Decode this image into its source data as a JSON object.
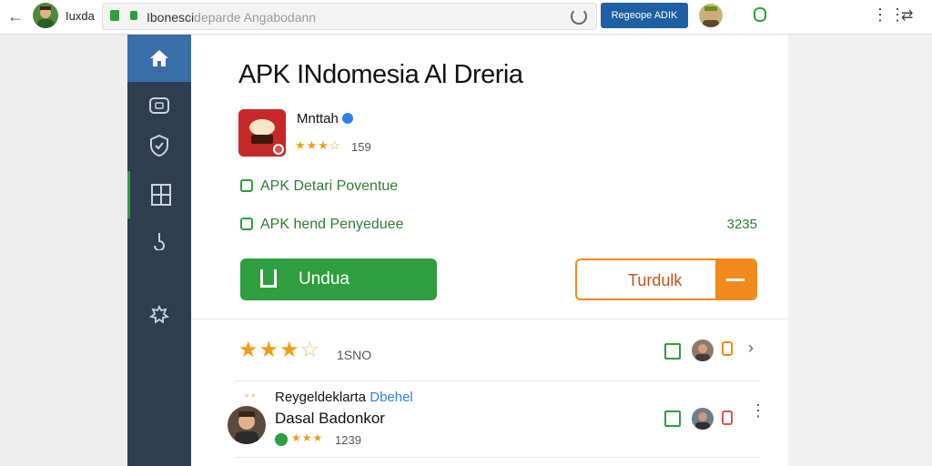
{
  "browser": {
    "back_glyph": "←",
    "profile_name": "Iuxda",
    "url_main": "Ibonesci",
    "url_faded": "deparde Angabodann",
    "top_button": "Regeope ADIK",
    "menu_glyph": "⋮⋮",
    "share_glyph": "⇄"
  },
  "sidebar": {
    "items": [
      {
        "name": "home",
        "active": true
      },
      {
        "name": "apps"
      },
      {
        "name": "shield"
      },
      {
        "name": "grid",
        "highlighted": true
      },
      {
        "name": "refresh"
      },
      {
        "name": "settings"
      }
    ]
  },
  "page": {
    "title": "APK INdomesia Al Dreria",
    "app": {
      "name": "Mnttah",
      "stars": "★★★☆",
      "rating_count": "159"
    },
    "features": [
      {
        "label": "APK Detari Poventue"
      },
      {
        "label": "APK hend Penyeduee",
        "value": "3235"
      }
    ],
    "download_button": "Undua",
    "alt_button": "Turdulk"
  },
  "reviews": {
    "summary_stars": "★★★",
    "summary_empty": "☆",
    "summary_count": "1SNO",
    "chevron_glyph": "›",
    "kebab_glyph": "⋮",
    "item": {
      "dots": "∘∘",
      "title": "Reygeldeklarta ",
      "title_blue": "Dbehel",
      "subtitle": "Dasal Badonkor",
      "stars": "★★★",
      "count": "1239"
    }
  },
  "colors": {
    "accent_green": "#2e9e3e",
    "accent_orange": "#f28a1b",
    "sidebar_bg": "#2e3e50",
    "sidebar_active": "#3a6ea8",
    "top_button_bg": "#1e5fa3"
  }
}
